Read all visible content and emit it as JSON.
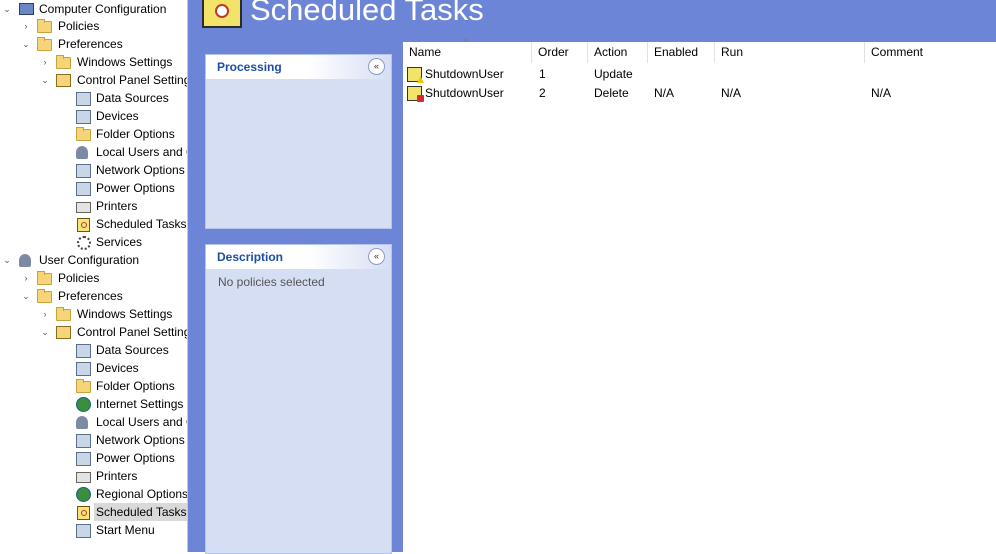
{
  "tree": {
    "computer_configuration": "Computer Configuration",
    "computer_items": {
      "policies": "Policies",
      "preferences": "Preferences",
      "windows_settings": "Windows Settings",
      "control_panel_settings": "Control Panel Settings",
      "data_sources": "Data Sources",
      "devices": "Devices",
      "folder_options": "Folder Options",
      "local_users_and_groups": "Local Users and Groups",
      "network_options": "Network Options",
      "power_options": "Power Options",
      "printers": "Printers",
      "scheduled_tasks": "Scheduled Tasks",
      "services": "Services"
    },
    "user_configuration": "User Configuration",
    "user_items": {
      "policies": "Policies",
      "preferences": "Preferences",
      "windows_settings": "Windows Settings",
      "control_panel_settings": "Control Panel Settings",
      "data_sources": "Data Sources",
      "devices": "Devices",
      "folder_options": "Folder Options",
      "internet_settings": "Internet Settings",
      "local_users_and_groups": "Local Users and Groups",
      "network_options": "Network Options",
      "power_options": "Power Options",
      "printers": "Printers",
      "regional_options": "Regional Options",
      "scheduled_tasks": "Scheduled Tasks",
      "start_menu": "Start Menu"
    },
    "selected": "User Configuration > Preferences > Control Panel Settings > Scheduled Tasks"
  },
  "header": {
    "title": "Scheduled Tasks"
  },
  "panels": {
    "processing": {
      "title": "Processing",
      "toggle": "«"
    },
    "description": {
      "title": "Description",
      "toggle": "«",
      "text": "No policies selected"
    }
  },
  "list": {
    "columns": [
      "Name",
      "Order",
      "Action",
      "Enabled",
      "Run",
      "Comment"
    ],
    "sort_indicator": "^",
    "rows": [
      {
        "name": "ShutdownUser",
        "order": "1",
        "action": "Update",
        "enabled": "",
        "run": "",
        "comment": "",
        "icon": "task-update-icon"
      },
      {
        "name": "ShutdownUser",
        "order": "2",
        "action": "Delete",
        "enabled": "N/A",
        "run": "N/A",
        "comment": "N/A",
        "icon": "task-delete-icon"
      }
    ]
  },
  "colors": {
    "accent": "#6d85d6",
    "panel_bg": "#d6def4",
    "panel_title": "#1c4fa1",
    "selection": "#d9d9d9"
  }
}
